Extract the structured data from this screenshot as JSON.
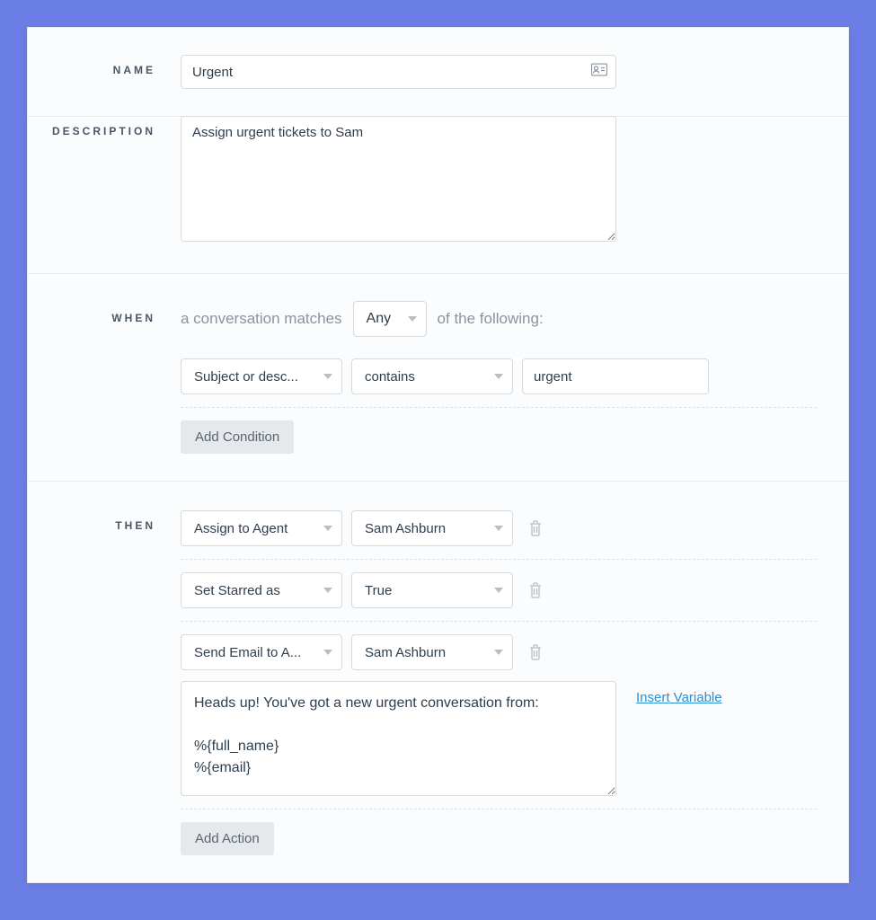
{
  "labels": {
    "name": "NAME",
    "description": "DESCRIPTION",
    "when": "WHEN",
    "then": "THEN"
  },
  "name_value": "Urgent",
  "description_value": "Assign urgent tickets to Sam",
  "when": {
    "prefix": "a conversation matches",
    "match_mode": "Any",
    "suffix": "of the following:",
    "conditions": [
      {
        "field": "Subject or desc...",
        "operator": "contains",
        "value": "urgent"
      }
    ],
    "add_condition_label": "Add Condition"
  },
  "then": {
    "actions": [
      {
        "type": "Assign to Agent",
        "value": "Sam Ashburn"
      },
      {
        "type": "Set Starred as",
        "value": "True"
      },
      {
        "type": "Send Email to A...",
        "value": "Sam Ashburn",
        "body": "Heads up! You've got a new urgent conversation from:\n\n%{full_name}\n%{email}"
      }
    ],
    "insert_variable_label": "Insert Variable",
    "add_action_label": "Add Action"
  }
}
